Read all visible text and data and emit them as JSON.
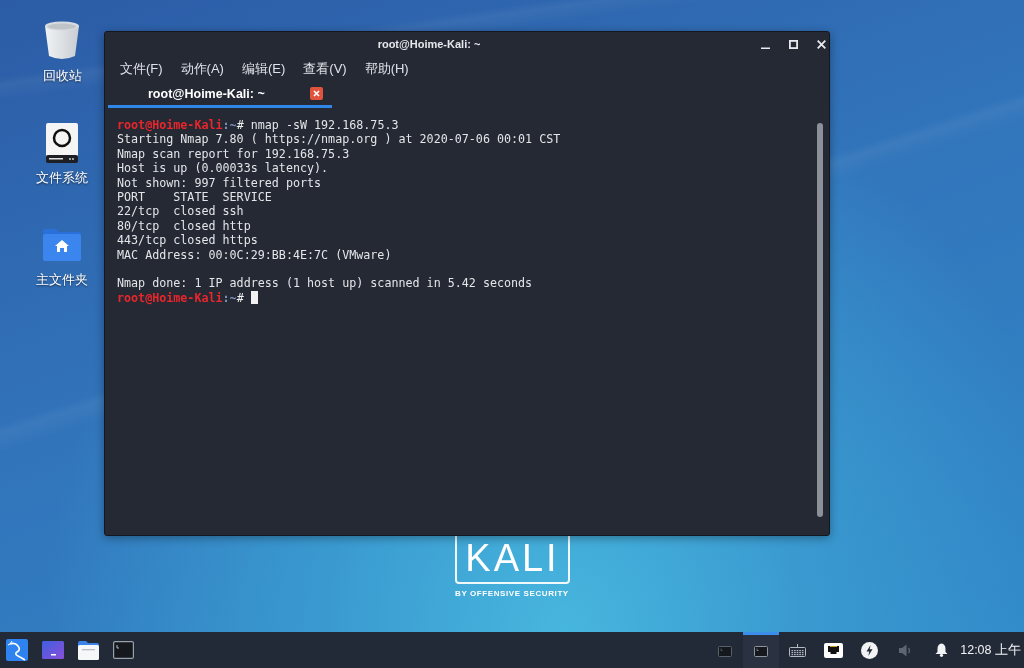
{
  "desktop_icons": [
    {
      "kind": "trash",
      "label": "回收站"
    },
    {
      "kind": "drive",
      "label": "文件系统"
    },
    {
      "kind": "home",
      "label": "主文件夹"
    }
  ],
  "wallpaper_logo": {
    "wordmark": "KALI",
    "tagline": "BY OFFENSIVE SECURITY"
  },
  "window": {
    "title": "root@Hoime-Kali: ~",
    "menu": [
      "文件(F)",
      "动作(A)",
      "编辑(E)",
      "查看(V)",
      "帮助(H)"
    ],
    "tabs": [
      {
        "label": "root@Hoime-Kali: ~",
        "selected": true
      }
    ],
    "terminal_lines": [
      {
        "kind": "prompt",
        "user": "root@Hoime-Kali",
        "path": ":~",
        "symbol": "#",
        "command": "nmap -sW 192.168.75.3",
        "cursor": false
      },
      {
        "kind": "output",
        "text": "Starting Nmap 7.80 ( https://nmap.org ) at 2020-07-06 00:01 CST"
      },
      {
        "kind": "output",
        "text": "Nmap scan report for 192.168.75.3"
      },
      {
        "kind": "output",
        "text": "Host is up (0.00033s latency)."
      },
      {
        "kind": "output",
        "text": "Not shown: 997 filtered ports"
      },
      {
        "kind": "output",
        "text": "PORT    STATE  SERVICE"
      },
      {
        "kind": "output",
        "text": "22/tcp  closed ssh"
      },
      {
        "kind": "output",
        "text": "80/tcp  closed http"
      },
      {
        "kind": "output",
        "text": "443/tcp closed https"
      },
      {
        "kind": "output",
        "text": "MAC Address: 00:0C:29:BB:4E:7C (VMware)"
      },
      {
        "kind": "blank"
      },
      {
        "kind": "output",
        "text": "Nmap done: 1 IP address (1 host up) scanned in 5.42 seconds"
      },
      {
        "kind": "prompt",
        "user": "root@Hoime-Kali",
        "path": ":~",
        "symbol": "#",
        "cursor": true
      }
    ]
  },
  "taskbar": {
    "launchers": [
      {
        "kind": "dragon"
      },
      {
        "kind": "screen"
      },
      {
        "kind": "folder"
      },
      {
        "kind": "terminal"
      }
    ],
    "tasks": [
      {
        "kind": "terminal",
        "selected": false
      },
      {
        "kind": "terminal",
        "selected": true
      }
    ],
    "tray": [
      {
        "kind": "keyboard"
      },
      {
        "kind": "network"
      },
      {
        "kind": "power"
      },
      {
        "kind": "volume"
      },
      {
        "kind": "notifications"
      }
    ],
    "clock": "12:08 上午"
  }
}
